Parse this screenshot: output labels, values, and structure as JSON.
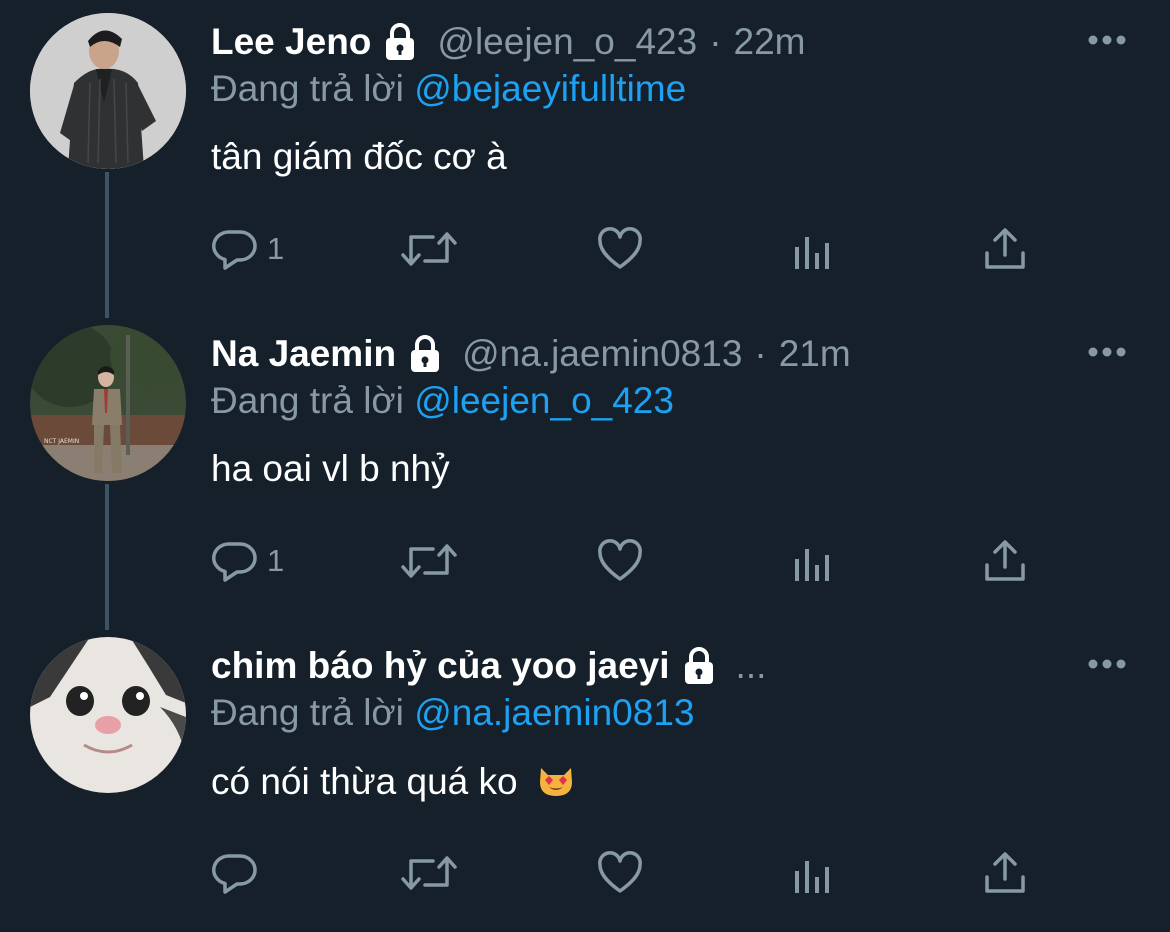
{
  "colors": {
    "background": "#15202b",
    "secondary_text": "#8899a6",
    "mention": "#1da1f2",
    "thread_line": "#3d5466"
  },
  "tweets": [
    {
      "name": "Lee Jeno",
      "handle": "@leejen_o_423",
      "dot": "·",
      "time": "22m",
      "replying_prefix": "Đang trả lời",
      "replying_to": "@bejaeyifulltime",
      "text": "tân giám đốc cơ à",
      "reply_count": "1",
      "icons": [
        "lock-icon",
        "reply-icon",
        "retweet-icon",
        "like-icon",
        "analytics-icon",
        "share-icon",
        "more-icon"
      ]
    },
    {
      "name": "Na Jaemin",
      "handle": "@na.jaemin0813",
      "dot": "·",
      "time": "21m",
      "replying_prefix": "Đang trả lời",
      "replying_to": "@leejen_o_423",
      "text": "ha oai vl b nhỷ",
      "reply_count": "1",
      "icons": [
        "lock-icon",
        "reply-icon",
        "retweet-icon",
        "like-icon",
        "analytics-icon",
        "share-icon",
        "more-icon"
      ]
    },
    {
      "name": "chim báo hỷ của yoo jaeyi",
      "truncation": "...",
      "replying_prefix": "Đang trả lời",
      "replying_to": "@na.jaemin0813",
      "text": "có nói thừa quá ko",
      "reply_count": "",
      "icons": [
        "lock-icon",
        "heart-eyes-cat-emoji",
        "reply-icon",
        "retweet-icon",
        "like-icon",
        "analytics-icon",
        "share-icon",
        "more-icon"
      ]
    }
  ]
}
